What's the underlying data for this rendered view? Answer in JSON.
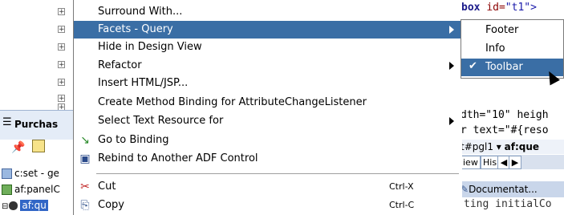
{
  "background": {
    "tree_expanders": [
      "+",
      "+",
      "+",
      "+",
      "+",
      "+",
      "+"
    ],
    "panel_title": "Purchas",
    "structure_rows": [
      {
        "icon": "tag-icon",
        "text": "c:set - ge"
      },
      {
        "icon": "component-icon",
        "text": "af:panelC"
      },
      {
        "icon": "binoculars-icon",
        "text": "af:qu"
      }
    ],
    "code_lines": {
      "top_tag": "box",
      "top_attr": "id=",
      "top_val": "\"t1\">",
      "mid1": "dth=\"10\" heigh",
      "mid2": "r text=\"#{reso",
      "breadcrumb_left": "t#pgl1 ▾",
      "breadcrumb_right": "af:que",
      "tab_view": "iew",
      "tab_history": "His",
      "doc_strip": "Documentat...",
      "bottom": "ting initialCo"
    }
  },
  "context_menu": {
    "items": [
      {
        "label": "Surround With...",
        "icon": "",
        "submenu": false,
        "highlighted": false,
        "accel": ""
      },
      {
        "label": "Facets - Query",
        "icon": "",
        "submenu": true,
        "highlighted": true,
        "accel": ""
      },
      {
        "label": "Hide in Design View",
        "icon": "",
        "submenu": false,
        "highlighted": false,
        "accel": ""
      },
      {
        "label": "Refactor",
        "icon": "",
        "submenu": true,
        "highlighted": false,
        "accel": ""
      },
      {
        "label": "Insert HTML/JSP...",
        "icon": "",
        "submenu": false,
        "highlighted": false,
        "accel": ""
      },
      {
        "label": "Create Method Binding for AttributeChangeListener",
        "icon": "",
        "submenu": false,
        "highlighted": false,
        "accel": ""
      },
      {
        "label": "Select Text Resource for",
        "icon": "",
        "submenu": true,
        "highlighted": false,
        "accel": ""
      },
      {
        "label": "Go to Binding",
        "icon": "goto-binding-icon",
        "submenu": false,
        "highlighted": false,
        "accel": ""
      },
      {
        "label": "Rebind to Another ADF Control",
        "icon": "rebind-icon",
        "submenu": false,
        "highlighted": false,
        "accel": ""
      },
      {
        "label": "Cut",
        "icon": "scissors-icon",
        "submenu": false,
        "highlighted": false,
        "accel": "Ctrl-X"
      },
      {
        "label": "Copy",
        "icon": "copy-icon",
        "submenu": false,
        "highlighted": false,
        "accel": "Ctrl-C"
      }
    ]
  },
  "submenu": {
    "items": [
      {
        "label": "Footer",
        "checked": false,
        "highlighted": false
      },
      {
        "label": "Info",
        "checked": false,
        "highlighted": false
      },
      {
        "label": "Toolbar",
        "checked": true,
        "highlighted": true
      }
    ]
  },
  "colors": {
    "highlight": "#3a6ea5",
    "selection": "#3166c6"
  }
}
